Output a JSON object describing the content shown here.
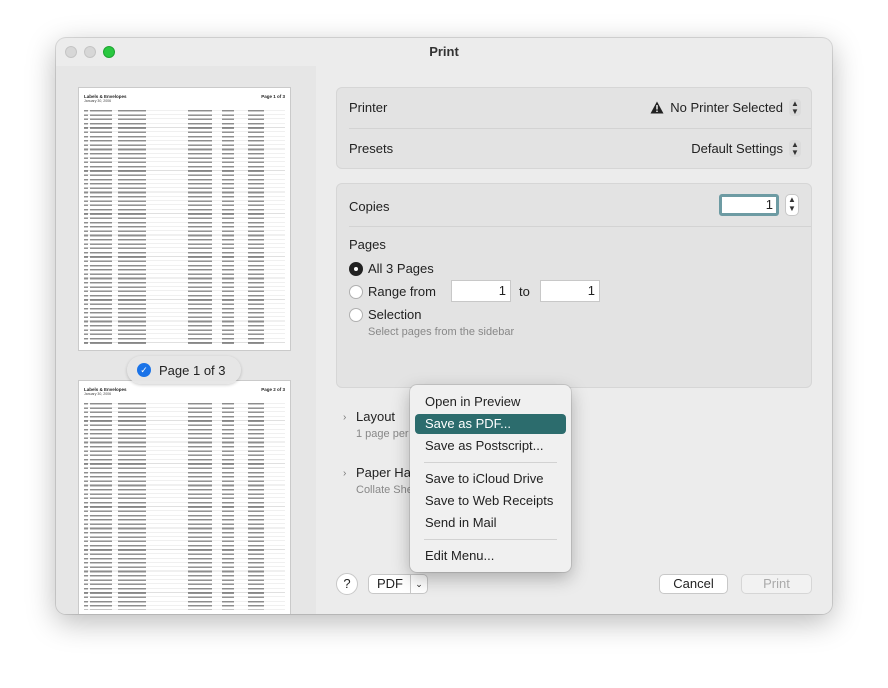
{
  "window": {
    "title": "Print"
  },
  "sidebar": {
    "thumbs": [
      {
        "title": "Labels & Envelopes",
        "page_label": "Page 1 of 3",
        "date": "January 30, 2006"
      },
      {
        "title": "Labels & Envelopes",
        "page_label": "Page 2 of 3",
        "date": "January 30, 2006"
      }
    ],
    "badge": "Page 1 of 3"
  },
  "printer": {
    "label": "Printer",
    "value": "No Printer Selected"
  },
  "presets": {
    "label": "Presets",
    "value": "Default Settings"
  },
  "copies": {
    "label": "Copies",
    "value": "1"
  },
  "pages": {
    "label": "Pages",
    "all": "All 3 Pages",
    "range": "Range from",
    "from": "1",
    "to_label": "to",
    "to": "1",
    "selection": "Selection",
    "hint": "Select pages from the sidebar"
  },
  "layout": {
    "label": "Layout",
    "sub": "1 page per"
  },
  "paper": {
    "label": "Paper Ha",
    "sub": "Collate She"
  },
  "buttons": {
    "help": "?",
    "pdf": "PDF",
    "cancel": "Cancel",
    "print": "Print"
  },
  "menu": {
    "items": [
      "Open in Preview",
      "Save as PDF...",
      "Save as Postscript...",
      "Save to iCloud Drive",
      "Save to Web Receipts",
      "Send in Mail",
      "Edit Menu..."
    ]
  }
}
